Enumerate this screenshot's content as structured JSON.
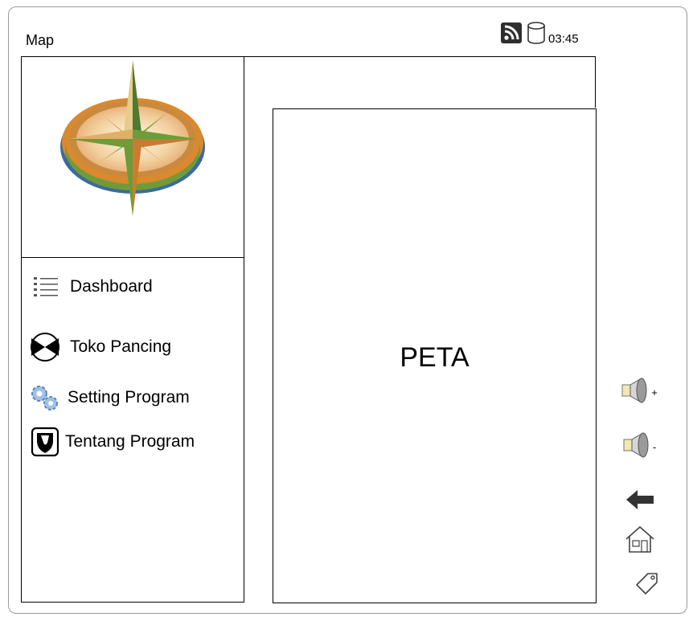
{
  "window": {
    "title": "Map"
  },
  "status_bar": {
    "time": "03:45",
    "icons": [
      "rss-icon",
      "database-icon"
    ]
  },
  "sidebar": {
    "logo": "compass-logo",
    "items": [
      {
        "label": "Dashboard",
        "icon": "list-icon"
      },
      {
        "label": "Toko Pancing",
        "icon": "bowtie-icon"
      },
      {
        "label": "Setting Program",
        "icon": "gears-icon"
      },
      {
        "label": "Tentang Program",
        "icon": "shield-icon"
      }
    ]
  },
  "map": {
    "label": "PETA"
  },
  "controls": {
    "volume_up_sign": "+",
    "volume_down_sign": "-",
    "icons": [
      "speaker-icon",
      "speaker-icon",
      "arrow-left-icon",
      "home-icon",
      "tag-icon"
    ]
  }
}
